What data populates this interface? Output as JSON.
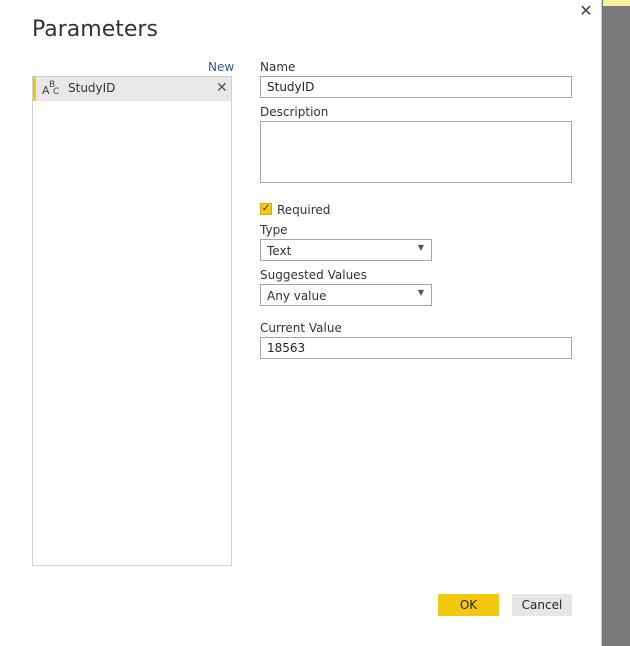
{
  "dialog": {
    "title": "Parameters",
    "close_label": "✕",
    "new_label": "New",
    "accent_color": "#f2c811"
  },
  "parameters_list": [
    {
      "icon": "abc-text-type-icon",
      "label": "StudyID",
      "remove_label": "✕"
    }
  ],
  "form": {
    "name_label": "Name",
    "name_value": "StudyID",
    "description_label": "Description",
    "description_value": "",
    "required_label": "Required",
    "required_checked": true,
    "type_label": "Type",
    "type_value": "Text",
    "suggested_label": "Suggested Values",
    "suggested_value": "Any value",
    "current_label": "Current Value",
    "current_value": "18563"
  },
  "buttons": {
    "ok": "OK",
    "cancel": "Cancel"
  }
}
